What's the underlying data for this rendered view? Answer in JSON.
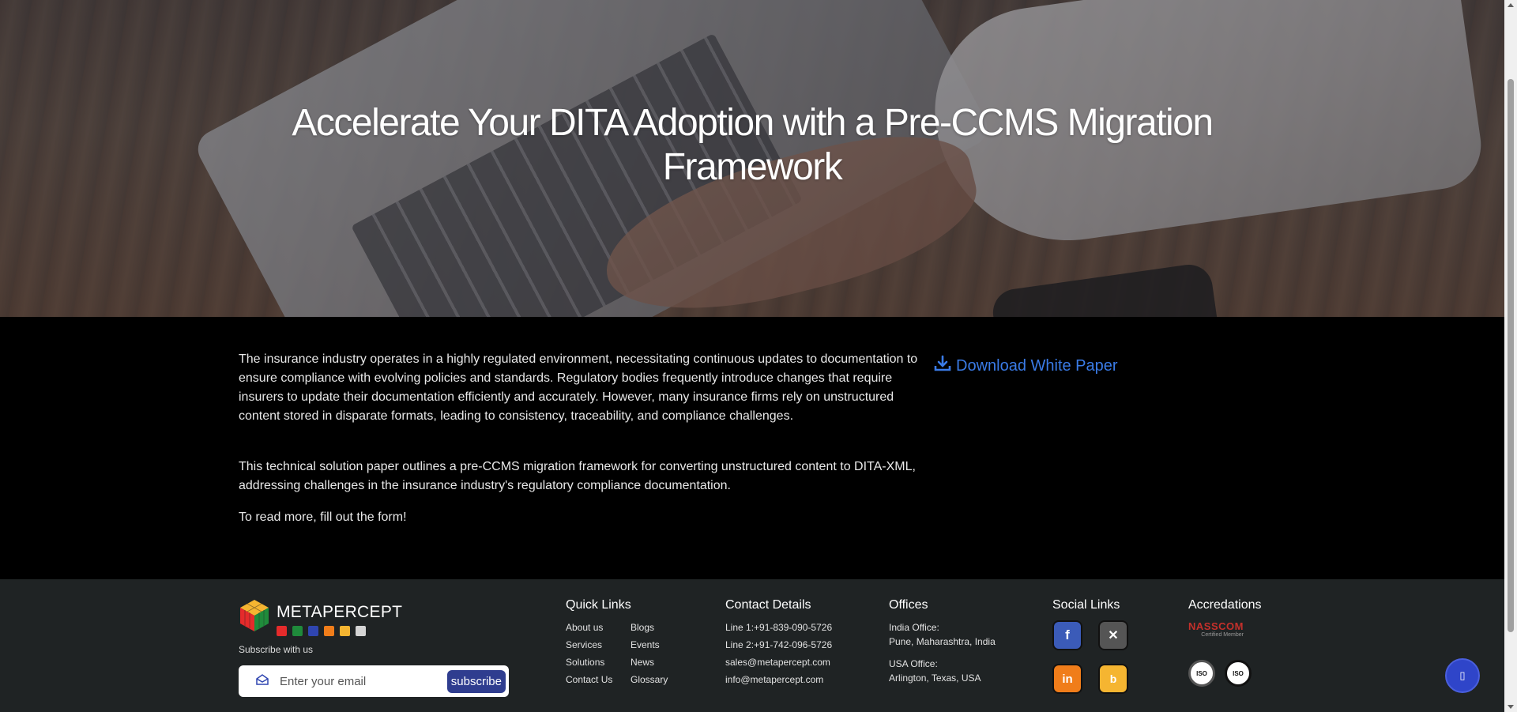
{
  "hero": {
    "title": "Accelerate Your DITA Adoption with a Pre-CCMS Migration Framework",
    "background_image": "laptop-typing-photo"
  },
  "main": {
    "paragraphs": [
      "The insurance industry operates in a highly regulated environment, necessitating continuous updates to documentation to ensure compliance with evolving policies and standards. Regulatory bodies frequently introduce changes that require insurers to update their documentation efficiently and accurately. However, many insurance firms rely on unstructured content stored in disparate formats, leading to consistency, traceability, and compliance challenges.",
      "This technical solution paper outlines a pre-CCMS migration framework for converting unstructured content to DITA-XML, addressing challenges in the insurance industry's regulatory compliance documentation.",
      "To read more, fill out the form!"
    ],
    "download_label": "Download White Paper",
    "download_icon": "download-icon",
    "accent_color": "#3a7be6"
  },
  "footer": {
    "logo_text": "METAPERCEPT",
    "logo_dot_colors": [
      "#e52b2b",
      "#1f8b3b",
      "#2f45b0",
      "#f07d1a",
      "#f5b531",
      "#d4d4d4"
    ],
    "subscribe_label": "Subscribe with us",
    "subscribe_placeholder": "Enter your email",
    "subscribe_button": "subscribe",
    "quick_links": {
      "title": "Quick Links",
      "col1": [
        "About us",
        "Services",
        "Solutions",
        "Contact Us"
      ],
      "col2": [
        "Blogs",
        "Events",
        "News",
        "Glossary"
      ]
    },
    "contact": {
      "title": "Contact Details",
      "items": [
        "Line 1:+91-839-090-5726",
        "Line 2:+91-742-096-5726",
        "sales@metapercept.com",
        "info@metapercept.com"
      ]
    },
    "offices": {
      "title": "Offices",
      "india_label": "India Office:",
      "india_address": "Pune, Maharashtra, India",
      "usa_label": "USA Office:",
      "usa_address": "Arlington, Texas, USA"
    },
    "social": {
      "title": "Social Links",
      "icons": [
        "facebook-icon",
        "x-icon",
        "linkedin-icon",
        "blog-icon"
      ],
      "colors": {
        "facebook": "#3b5bb8",
        "x": "#555555",
        "linkedin": "#f07d1a",
        "blog": "#f5b531"
      }
    },
    "accreditations": {
      "title": "Accredations",
      "nasscom": "NASSCOM",
      "nasscom_sub": "Certified Member",
      "iso_badges": [
        "ISO",
        "ISO"
      ]
    }
  },
  "chat_button_icon": "chat-icon"
}
